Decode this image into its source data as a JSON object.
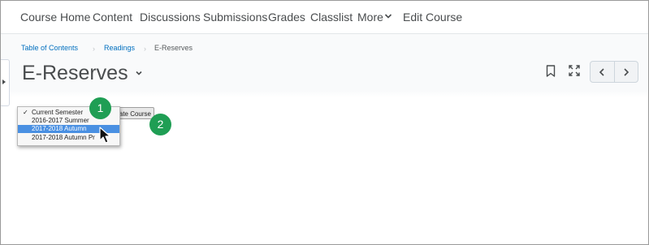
{
  "navbar": {
    "items": [
      {
        "label": "Course Home"
      },
      {
        "label": "Content"
      },
      {
        "label": "Discussions"
      },
      {
        "label": "Submissions"
      },
      {
        "label": "Grades"
      },
      {
        "label": "Classlist"
      },
      {
        "label": "More"
      },
      {
        "label": "Edit Course"
      }
    ]
  },
  "breadcrumb": {
    "items": [
      {
        "label": "Table of Contents"
      },
      {
        "label": "Readings"
      },
      {
        "label": "E-Reserves"
      }
    ]
  },
  "page": {
    "title": "E-Reserves"
  },
  "toolbar": {
    "bookmark_icon": "bookmark-icon",
    "fullscreen_icon": "fullscreen-icon"
  },
  "semester_select": {
    "options": [
      {
        "label": "Current Semester",
        "checked": true
      },
      {
        "label": "2016-2017 Summer"
      },
      {
        "label": "2017-2018 Autumn",
        "highlighted": true
      },
      {
        "label": "2017-2018 Autumn Pr"
      }
    ]
  },
  "update_button": {
    "label": "Update Course"
  },
  "annotations": {
    "step1": "1",
    "step2": "2",
    "badge_color": "#1f9e54"
  },
  "colors": {
    "link": "#006fbf",
    "highlight": "#4a90e2",
    "text": "#494c4e"
  }
}
